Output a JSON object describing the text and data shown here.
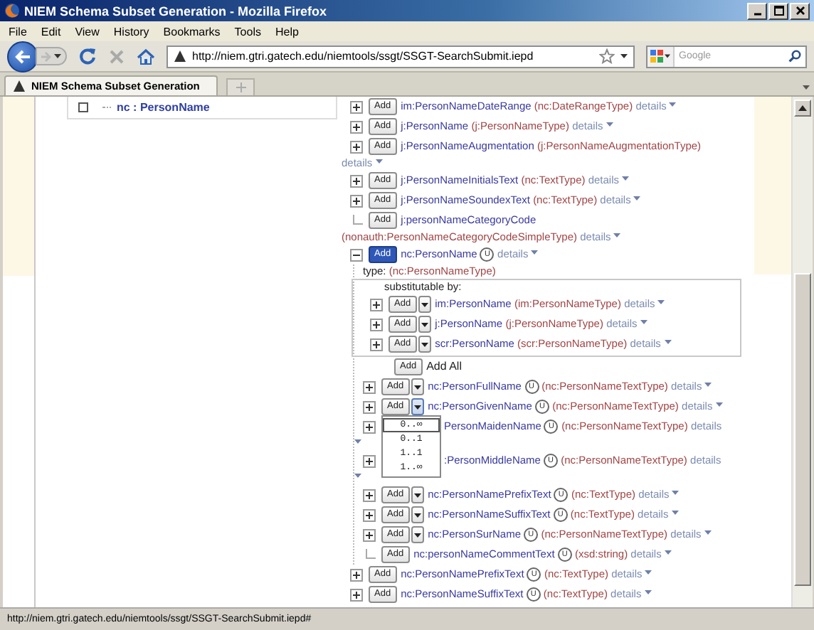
{
  "window": {
    "title": "NIEM Schema Subset Generation - Mozilla Firefox"
  },
  "menu": [
    "File",
    "Edit",
    "View",
    "History",
    "Bookmarks",
    "Tools",
    "Help"
  ],
  "address": {
    "url": "http://niem.gtri.gatech.edu/niemtools/ssgt/SSGT-SearchSubmit.iepd"
  },
  "search": {
    "placeholder": "Google"
  },
  "tabs": [
    {
      "label": "NIEM Schema Subset Generation",
      "selected": true
    }
  ],
  "left_tree": {
    "checked": false,
    "label": "nc : PersonName"
  },
  "tree": [
    {
      "kind": "element",
      "leaf": false,
      "expanded": false,
      "button": "Add",
      "dropdown": false,
      "selected": false,
      "name": "im:PersonNameDateRange",
      "type": "(nc:DateRangeType)",
      "details": "details"
    },
    {
      "kind": "element",
      "leaf": false,
      "expanded": false,
      "button": "Add",
      "dropdown": false,
      "selected": false,
      "name": "j:PersonName",
      "type": "(j:PersonNameType)",
      "details": "details"
    },
    {
      "kind": "element",
      "leaf": false,
      "expanded": false,
      "button": "Add",
      "dropdown": false,
      "selected": false,
      "name": "j:PersonNameAugmentation",
      "type": "(j:PersonNameAugmentationType)",
      "details": "details"
    },
    {
      "kind": "element",
      "leaf": false,
      "expanded": false,
      "button": "Add",
      "dropdown": false,
      "selected": false,
      "name": "j:PersonNameInitialsText",
      "type": "(nc:TextType)",
      "details": "details"
    },
    {
      "kind": "element",
      "leaf": false,
      "expanded": false,
      "button": "Add",
      "dropdown": false,
      "selected": false,
      "name": "j:PersonNameSoundexText",
      "type": "(nc:TextType)",
      "details": "details"
    },
    {
      "kind": "element",
      "leaf": true,
      "button": "Add",
      "dropdown": false,
      "selected": false,
      "name": "j:personNameCategoryCode",
      "type": "(nonauth:PersonNameCategoryCodeSimpleType)",
      "details": "details"
    },
    {
      "kind": "element",
      "leaf": false,
      "expanded": true,
      "button": "Add",
      "dropdown": false,
      "selected": true,
      "name": "nc:PersonName",
      "badge": "U",
      "details": "details",
      "children": [
        {
          "kind": "type_line",
          "label": "type:",
          "type": "(nc:PersonNameType)"
        },
        {
          "kind": "substitution_group",
          "label": "substitutable by:",
          "rows": [
            {
              "kind": "element",
              "leaf": false,
              "expanded": false,
              "button": "Add",
              "dropdown": true,
              "selected": false,
              "name": "im:PersonName",
              "type": "(im:PersonNameType)",
              "details": "details"
            },
            {
              "kind": "element",
              "leaf": false,
              "expanded": false,
              "button": "Add",
              "dropdown": true,
              "selected": false,
              "name": "j:PersonName",
              "type": "(j:PersonNameType)",
              "details": "details"
            },
            {
              "kind": "element",
              "leaf": false,
              "expanded": false,
              "button": "Add",
              "dropdown": true,
              "selected": false,
              "name": "scr:PersonName",
              "type": "(scr:PersonNameType)",
              "details": "details"
            }
          ]
        },
        {
          "kind": "add_all",
          "button": "Add",
          "label": "Add All"
        },
        {
          "kind": "element",
          "leaf": false,
          "expanded": false,
          "button": "Add",
          "dropdown": true,
          "selected": false,
          "name": "nc:PersonFullName",
          "badge": "U",
          "type": "(nc:PersonNameTextType)",
          "details": "details"
        },
        {
          "kind": "element",
          "leaf": false,
          "expanded": false,
          "button": "Add",
          "dropdown": true,
          "selected": false,
          "menu_open": true,
          "name": "nc:PersonGivenName",
          "badge": "U",
          "type": "(nc:PersonNameTextType)",
          "details": "details"
        },
        {
          "kind": "element",
          "leaf": false,
          "expanded": false,
          "name": "PersonMaidenName",
          "badge": "U",
          "type": "(nc:PersonNameTextType)",
          "details": "details"
        },
        {
          "kind": "element",
          "leaf": false,
          "expanded": false,
          "name": ":PersonMiddleName",
          "badge": "U",
          "type": "(nc:PersonNameTextType)",
          "details": "details"
        },
        {
          "kind": "element",
          "leaf": false,
          "expanded": false,
          "button": "Add",
          "dropdown": true,
          "selected": false,
          "name": "nc:PersonNamePrefixText",
          "badge": "U",
          "type": "(nc:TextType)",
          "details": "details"
        },
        {
          "kind": "element",
          "leaf": false,
          "expanded": false,
          "button": "Add",
          "dropdown": true,
          "selected": false,
          "name": "nc:PersonNameSuffixText",
          "badge": "U",
          "type": "(nc:TextType)",
          "details": "details"
        },
        {
          "kind": "element",
          "leaf": false,
          "expanded": false,
          "button": "Add",
          "dropdown": true,
          "selected": false,
          "name": "nc:PersonSurName",
          "badge": "U",
          "type": "(nc:PersonNameTextType)",
          "details": "details"
        },
        {
          "kind": "element",
          "leaf": true,
          "button": "Add",
          "dropdown": false,
          "selected": false,
          "name": "nc:personNameCommentText",
          "badge": "U",
          "type": "(xsd:string)",
          "details": "details"
        }
      ]
    },
    {
      "kind": "element",
      "leaf": false,
      "expanded": false,
      "button": "Add",
      "dropdown": false,
      "selected": false,
      "name": "nc:PersonNamePrefixText",
      "badge": "U",
      "type": "(nc:TextType)",
      "details": "details"
    },
    {
      "kind": "element",
      "leaf": false,
      "expanded": false,
      "button": "Add",
      "dropdown": false,
      "selected": false,
      "name": "nc:PersonNameSuffixText",
      "badge": "U",
      "type": "(nc:TextType)",
      "details": "details"
    }
  ],
  "cardinality_menu": [
    {
      "label": "0..∞",
      "selected": true
    },
    {
      "label": "0..1",
      "selected": false
    },
    {
      "label": "1..1",
      "selected": false
    },
    {
      "label": "1..∞",
      "selected": false
    }
  ],
  "status_bar": "http://niem.gtri.gatech.edu/niemtools/ssgt/SSGT-SearchSubmit.iepd#"
}
